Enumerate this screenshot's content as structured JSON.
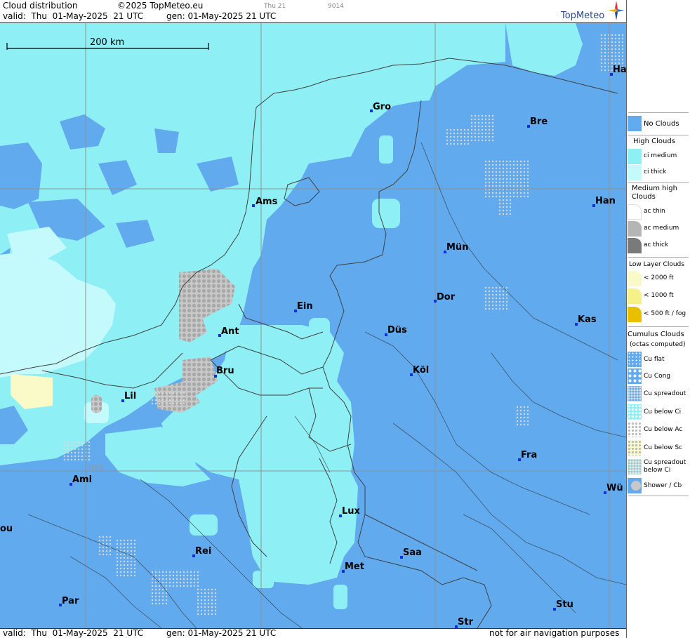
{
  "header": {
    "title": "Cloud distribution",
    "copyright": "©2025 TopMeteo.eu",
    "valid": "valid:  Thu  01-May-2025  21 UTC",
    "gen": "gen: 01-May-2025 21 UTC",
    "tiny_time": "Thu 21",
    "tiny_code": "9014",
    "logo": "TopMeteo"
  },
  "footer": {
    "valid": "valid:  Thu  01-May-2025  21 UTC",
    "gen": "gen: 01-May-2025 21 UTC",
    "disclaimer": "not for air navigation purposes"
  },
  "map": {
    "scale_label": "200 km",
    "grid_label": "N50",
    "cities": [
      "Gro",
      "Bre",
      "Ha",
      "Ams",
      "Han",
      "Mün",
      "Ein",
      "Dor",
      "Ant",
      "Düs",
      "Kas",
      "Bru",
      "Köl",
      "Lil",
      "Fra",
      "Ami",
      "Wü",
      "Lux",
      "ou",
      "Rei",
      "Saa",
      "Met",
      "Par",
      "Stu",
      "Str"
    ]
  },
  "legend": {
    "no_clouds": "No Clouds",
    "high_head": "High Clouds",
    "ci_medium": "ci medium",
    "ci_thick": "ci thick",
    "medium_head": "Medium high Clouds",
    "ac_thin": "ac thin",
    "ac_medium": "ac medium",
    "ac_thick": "ac thick",
    "low_head": "Low Layer Clouds",
    "low_2000": "< 2000 ft",
    "low_1000": "< 1000 ft",
    "low_500": "< 500 ft / fog",
    "cu_head": "Cumulus Clouds",
    "cu_sub": "(octas computed)",
    "cu_flat": "Cu flat",
    "cu_cong": "Cu Cong",
    "cu_spreadout": "Cu spreadout",
    "cu_below_ci": "Cu below Ci",
    "cu_below_ac": "Cu below Ac",
    "cu_below_sc": "Cu below Sc",
    "cu_spread_ci_1": "Cu spreadout",
    "cu_spread_ci_2": "below Ci",
    "shower_cb": "Shower / Cb"
  },
  "colors": {
    "no_clouds": "#62aaee",
    "ci_medium": "#8ef0f4",
    "ci_thick": "#c4fafc",
    "ac_medium": "#b5b5b5",
    "ac_thick": "#7a7a7a",
    "low_2000": "#fafac8",
    "low_1000": "#f6f088",
    "low_500": "#e8c000"
  }
}
